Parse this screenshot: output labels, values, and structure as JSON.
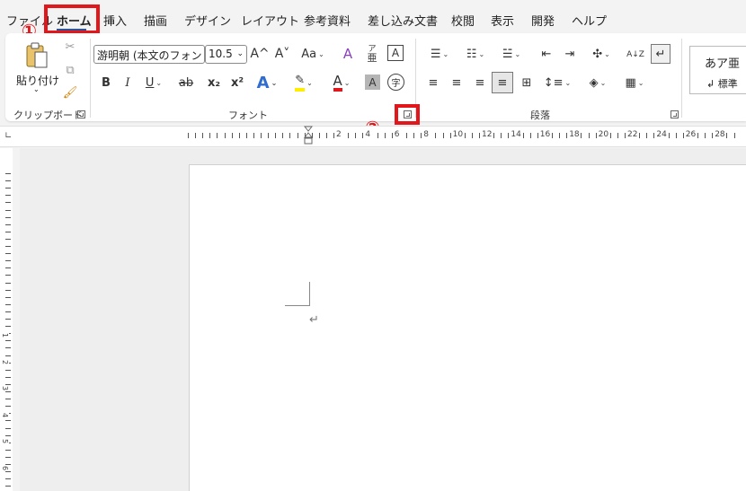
{
  "menu": {
    "tabs": [
      "ファイル",
      "ホーム",
      "挿入",
      "描画",
      "デザイン",
      "レイアウト",
      "参考資料",
      "差し込み文書",
      "校閲",
      "表示",
      "開発",
      "ヘルプ"
    ]
  },
  "annotations": {
    "one": "①",
    "two": "②"
  },
  "clipboard": {
    "paste_label": "貼り付け",
    "group_label": "クリップボード"
  },
  "font": {
    "font_name": "游明朝 (本文のフォン",
    "font_size": "10.5",
    "group_label": "フォント",
    "bold": "B",
    "italic": "I",
    "underline": "U",
    "strike": "ab",
    "sub": "x₂",
    "sup": "x²",
    "grow": "A^",
    "shrink": "A˅",
    "case": "Aa",
    "clear": "A",
    "phonetic_top": "ア",
    "phonetic_bottom": "亜",
    "border_a": "A",
    "effect_a": "A",
    "highlight": "✎",
    "font_color": "A",
    "shading_a": "A",
    "enclose": "字"
  },
  "paragraph": {
    "group_label": "段落",
    "sort": "A↓Z"
  },
  "styles": {
    "sample": "あア亜",
    "name": "↲ 標準"
  },
  "ruler": {
    "h_numbers": [
      "2",
      "4",
      "6",
      "8",
      "10",
      "12",
      "14",
      "16",
      "18",
      "20",
      "22",
      "24",
      "26",
      "28"
    ],
    "v_numbers": [
      "1",
      "2",
      "3",
      "4",
      "5",
      "6",
      "7"
    ]
  },
  "document": {
    "para_mark": "↵"
  },
  "colors": {
    "accent": "#2b579a",
    "highlight_red": "#e3161b",
    "highlight_yellow": "#ffee00"
  }
}
